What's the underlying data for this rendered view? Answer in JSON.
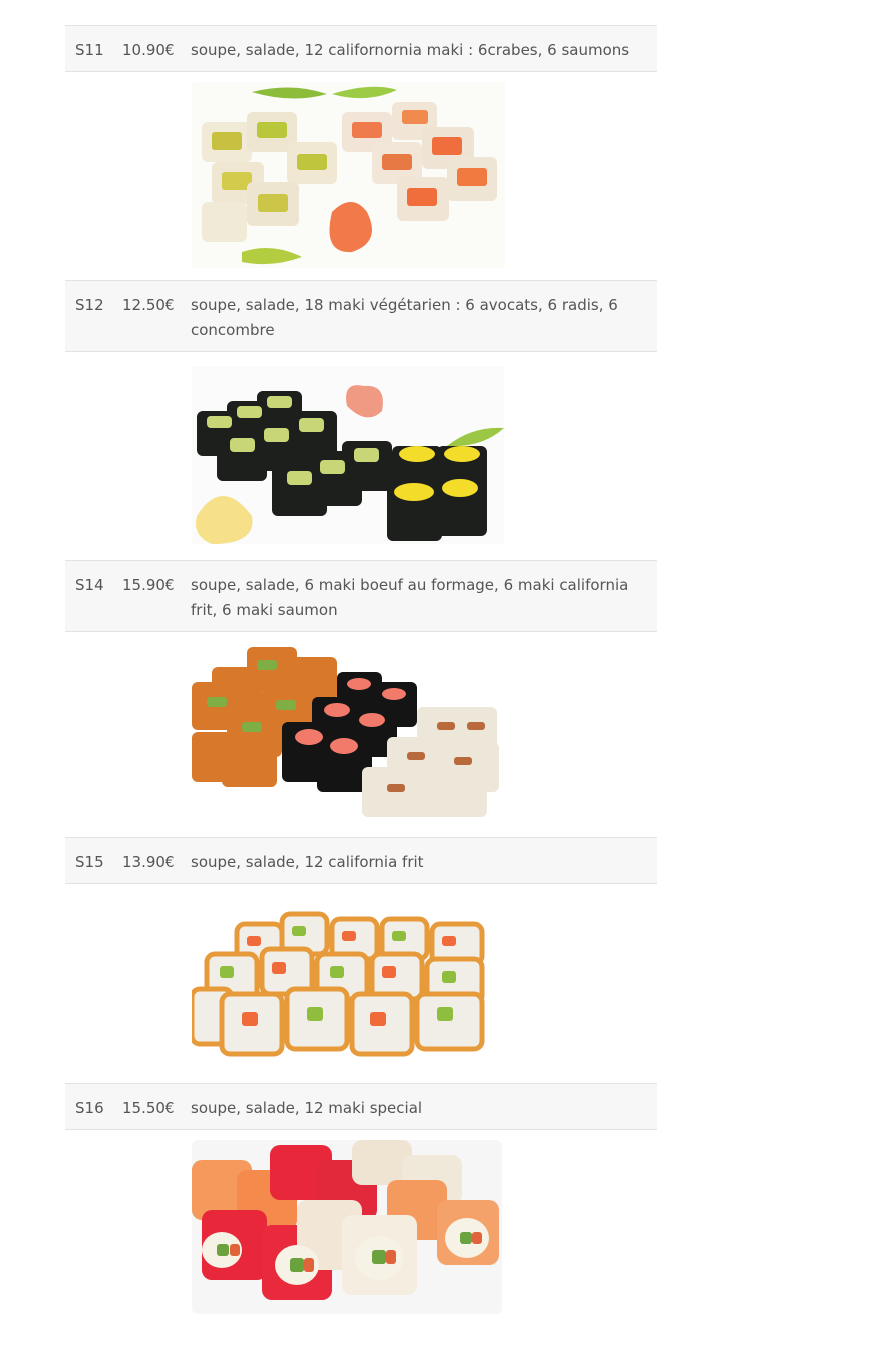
{
  "items": [
    {
      "code": "S11",
      "price": "10.90€",
      "desc": "soupe, salade, 12 californornia maki : 6crabes, 6 saumons",
      "image": "sushi-california-crab-salmon-photo"
    },
    {
      "code": "S12",
      "price": "12.50€",
      "desc": "soupe, salade, 18 maki végétarien : 6 avocats, 6 radis, 6 concombre",
      "image": "sushi-vegetarian-maki-photo"
    },
    {
      "code": "S14",
      "price": "15.90€",
      "desc": "soupe, salade, 6 maki boeuf au formage, 6 maki california frit, 6 maki saumon",
      "image": "sushi-beef-california-salmon-photo"
    },
    {
      "code": "S15",
      "price": "13.90€",
      "desc": "soupe, salade, 12 california frit",
      "image": "sushi-fried-california-photo"
    },
    {
      "code": "S16",
      "price": "15.50€",
      "desc": "soupe, salade, 12 maki special",
      "image": "sushi-special-maki-photo"
    }
  ],
  "colors": {
    "row_bg": "#f7f7f7",
    "text": "#555555",
    "divider": "#e2e2e2"
  }
}
